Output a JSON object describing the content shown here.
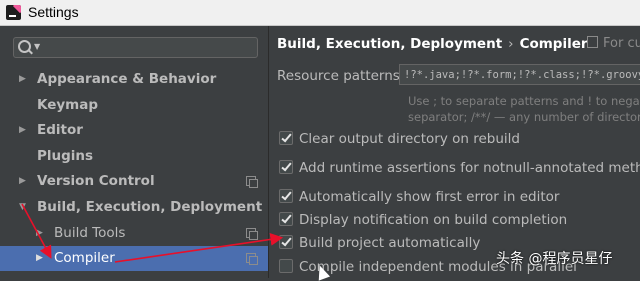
{
  "window": {
    "title": "Settings"
  },
  "search": {
    "placeholder": ""
  },
  "sidebar": {
    "items": [
      {
        "label": "Appearance & Behavior",
        "arrow": "▶"
      },
      {
        "label": "Keymap"
      },
      {
        "label": "Editor",
        "arrow": "▶"
      },
      {
        "label": "Plugins"
      },
      {
        "label": "Version Control",
        "arrow": "▶"
      },
      {
        "label": "Build, Execution, Deployment",
        "arrow": "▼"
      },
      {
        "label": "Build Tools",
        "arrow": "▶"
      },
      {
        "label": "Compiler",
        "arrow": "▶"
      }
    ]
  },
  "header": {
    "crumb_parent": "Build, Execution, Deployment",
    "separator": "›",
    "crumb_current": "Compiler",
    "scope_text": "For cur"
  },
  "resource": {
    "label": "Resource patterns:",
    "value": "!?*.java;!?*.form;!?*.class;!?*.groovy",
    "hint_line1": "Use ; to separate patterns and ! to negate a",
    "hint_line2": "separator; /**/ — any number of directories"
  },
  "options": [
    {
      "label": "Clear output directory on rebuild",
      "checked": true
    },
    {
      "label": "Add runtime assertions for notnull-annotated methods ar",
      "checked": true
    },
    {
      "label": "Automatically show first error in editor",
      "checked": true
    },
    {
      "label": "Display notification on build completion",
      "checked": true
    },
    {
      "label": "Build project automatically",
      "checked": true
    },
    {
      "label": "Compile independent modules in parallel",
      "checked": false
    }
  ],
  "watermark": "头条 @程序员星仔",
  "colors": {
    "selection": "#4b6eaf",
    "annotation": "#e8102a",
    "background": "#3c3f41"
  }
}
